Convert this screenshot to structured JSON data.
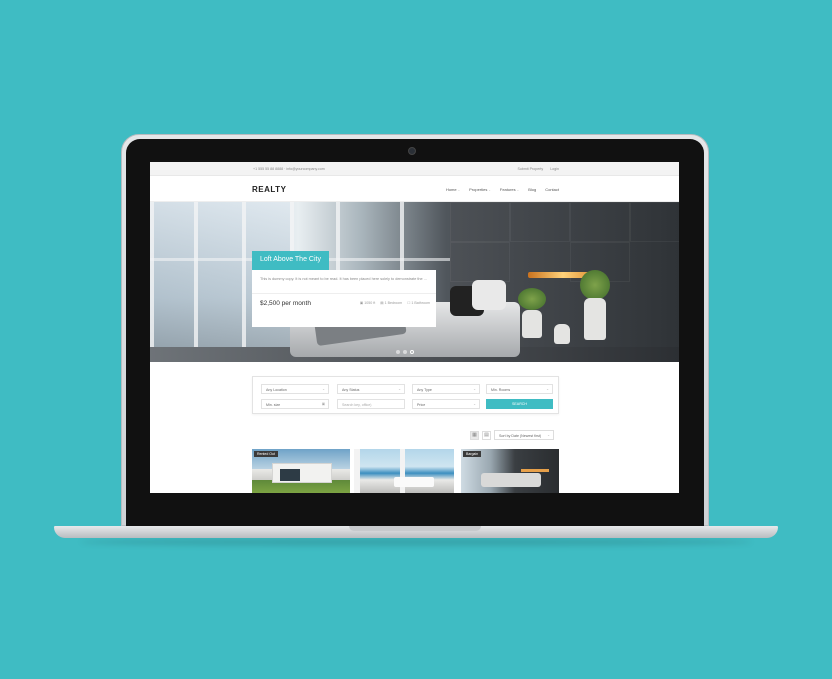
{
  "topbar": {
    "contact": "+1 555 55 88 8888 · info@yourcompany.com",
    "links": [
      "Submit Property",
      "Login"
    ]
  },
  "header": {
    "logo": "REALTY",
    "nav": [
      {
        "label": "Home",
        "caret": "⌄"
      },
      {
        "label": "Properties",
        "caret": "⌄"
      },
      {
        "label": "Features",
        "caret": "⌄"
      },
      {
        "label": "Blog",
        "caret": ""
      },
      {
        "label": "Contact",
        "caret": ""
      }
    ]
  },
  "hero": {
    "title": "Loft Above The City",
    "description": "This is dummy copy. It is not meant to be read. It has been placed here solely to demonstrate the ...",
    "price": "$2,500 per month",
    "meta": [
      "▣ 1050 ft",
      "▤ 1 Bedroom",
      "☐ 1 Bathroom"
    ],
    "slides": 3,
    "active_slide": 3
  },
  "search": {
    "location": "Any Location",
    "status": "Any Status",
    "type": "Any Type",
    "min_rooms": "Min. Rooms",
    "max_size": "Min. size",
    "keyword_placeholder": "Search key, office)",
    "price": "Price",
    "button": "SEARCH"
  },
  "listing": {
    "sort": "Sort by Date (Newest first)",
    "badges": [
      "Rented Out",
      "Bargain"
    ]
  },
  "colors": {
    "accent": "#3fbcc3",
    "background": "#3fbcc3"
  },
  "icons": [
    "camera-icon",
    "grid-view-icon",
    "list-view-icon",
    "chevron-down-icon",
    "calendar-icon"
  ]
}
